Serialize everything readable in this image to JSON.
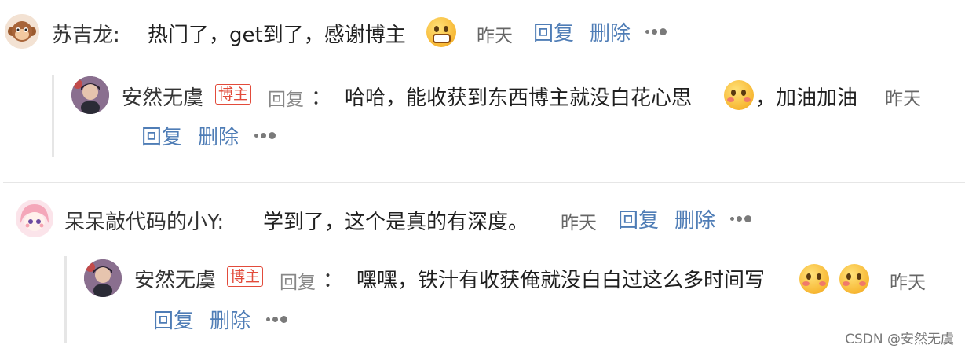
{
  "comments": [
    {
      "author": "苏吉龙:",
      "content": "热门了，get到了，感谢博主",
      "emoji": "grin-emoji",
      "time": "昨天",
      "reply_action": "回复",
      "delete_action": "删除",
      "reply": {
        "author": "安然无虞",
        "badge": "博主",
        "reply_label": "回复",
        "colon": "：",
        "content": "哈哈，能收获到东西博主就没白花心思",
        "content_after": "，加油加油",
        "emoji": "heart-kiss-emoji",
        "time": "昨天",
        "reply_action": "回复",
        "delete_action": "删除"
      }
    },
    {
      "author": "呆呆敲代码的小Y:",
      "content": "学到了，这个是真的有深度。",
      "time": "昨天",
      "reply_action": "回复",
      "delete_action": "删除",
      "reply": {
        "author": "安然无虞",
        "badge": "博主",
        "reply_label": "回复",
        "colon": "：",
        "content": "嘿嘿，铁汁有收获俺就没白白过这么多时间写",
        "emoji": "heart-kiss-emoji",
        "time": "昨天",
        "reply_action": "回复",
        "delete_action": "删除"
      }
    }
  ],
  "watermark": "CSDN @安然无虞",
  "colors": {
    "action": "#4f7db6",
    "badge": "#e24b3b",
    "text": "#1f1f1f",
    "muted": "#666666"
  }
}
